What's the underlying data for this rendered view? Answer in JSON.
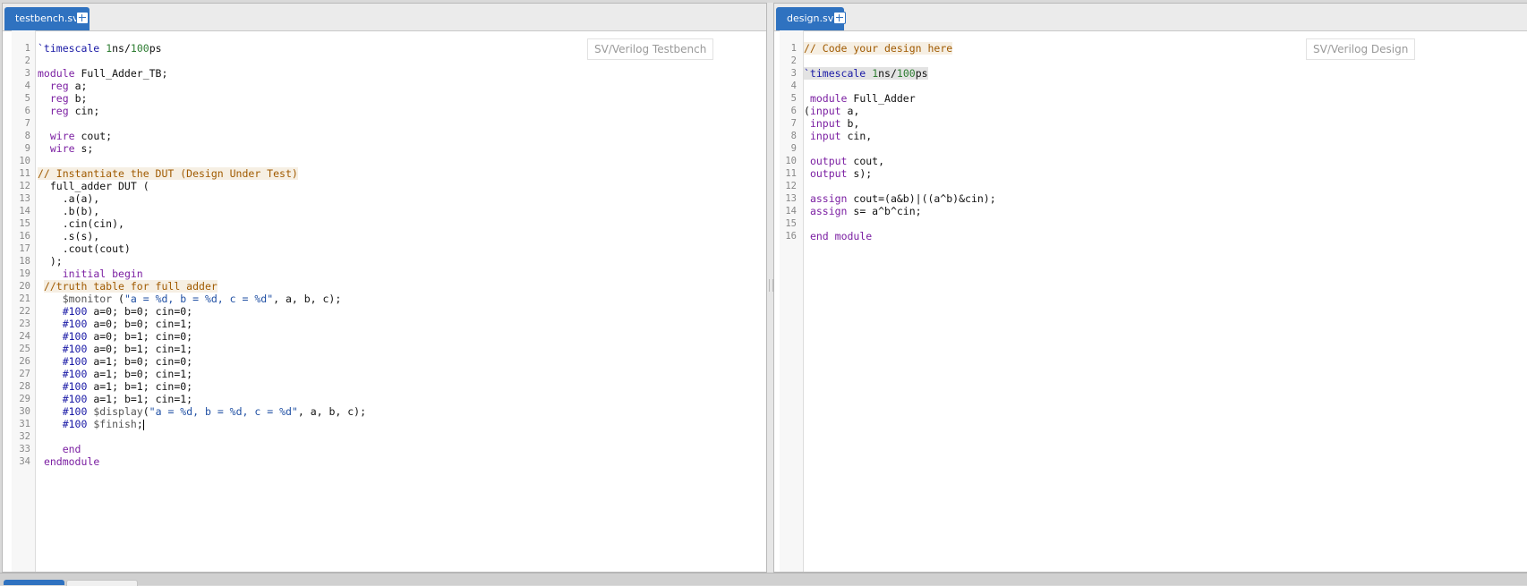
{
  "left": {
    "tab_label": "testbench.sv",
    "hint": "SV/Verilog Testbench",
    "lines": [
      {
        "n": "1",
        "t": "`timescale 1ns/100ps"
      },
      {
        "n": "2",
        "t": ""
      },
      {
        "n": "3",
        "t": "module Full_Adder_TB;"
      },
      {
        "n": "4",
        "t": "  reg a;"
      },
      {
        "n": "5",
        "t": "  reg b;"
      },
      {
        "n": "6",
        "t": "  reg cin;"
      },
      {
        "n": "7",
        "t": ""
      },
      {
        "n": "8",
        "t": "  wire cout;"
      },
      {
        "n": "9",
        "t": "  wire s;"
      },
      {
        "n": "10",
        "t": ""
      },
      {
        "n": "11",
        "t": "// Instantiate the DUT (Design Under Test)"
      },
      {
        "n": "12",
        "t": "  full_adder DUT ("
      },
      {
        "n": "13",
        "t": "    .a(a),"
      },
      {
        "n": "14",
        "t": "    .b(b),"
      },
      {
        "n": "15",
        "t": "    .cin(cin),"
      },
      {
        "n": "16",
        "t": "    .s(s),"
      },
      {
        "n": "17",
        "t": "    .cout(cout)"
      },
      {
        "n": "18",
        "t": "  );"
      },
      {
        "n": "19",
        "t": "    initial begin"
      },
      {
        "n": "20",
        "t": " //truth table for full adder"
      },
      {
        "n": "21",
        "t": "    $monitor (\"a = %d, b = %d, c = %d\", a, b, c);"
      },
      {
        "n": "22",
        "t": "    #100 a=0; b=0; cin=0;"
      },
      {
        "n": "23",
        "t": "    #100 a=0; b=0; cin=1;"
      },
      {
        "n": "24",
        "t": "    #100 a=0; b=1; cin=0;"
      },
      {
        "n": "25",
        "t": "    #100 a=0; b=1; cin=1;"
      },
      {
        "n": "26",
        "t": "    #100 a=1; b=0; cin=0;"
      },
      {
        "n": "27",
        "t": "    #100 a=1; b=0; cin=1;"
      },
      {
        "n": "28",
        "t": "    #100 a=1; b=1; cin=0;"
      },
      {
        "n": "29",
        "t": "    #100 a=1; b=1; cin=1;"
      },
      {
        "n": "30",
        "t": "    #100 $display(\"a = %d, b = %d, c = %d\", a, b, c);"
      },
      {
        "n": "31",
        "t": "    #100 $finish;"
      },
      {
        "n": "32",
        "t": ""
      },
      {
        "n": "33",
        "t": "    end"
      },
      {
        "n": "34",
        "t": " endmodule"
      }
    ]
  },
  "right": {
    "tab_label": "design.sv",
    "hint": "SV/Verilog Design",
    "lines": [
      {
        "n": "1",
        "t": "// Code your design here"
      },
      {
        "n": "2",
        "t": ""
      },
      {
        "n": "3",
        "t": "`timescale 1ns/100ps"
      },
      {
        "n": "4",
        "t": ""
      },
      {
        "n": "5",
        "t": " module Full_Adder"
      },
      {
        "n": "6",
        "t": "(input a,"
      },
      {
        "n": "7",
        "t": " input b,"
      },
      {
        "n": "8",
        "t": " input cin,"
      },
      {
        "n": "9",
        "t": ""
      },
      {
        "n": "10",
        "t": " output cout,"
      },
      {
        "n": "11",
        "t": " output s);"
      },
      {
        "n": "12",
        "t": ""
      },
      {
        "n": "13",
        "t": " assign cout=(a&b)|((a^b)&cin);"
      },
      {
        "n": "14",
        "t": " assign s= a^b^cin;"
      },
      {
        "n": "15",
        "t": ""
      },
      {
        "n": "16",
        "t": " end module"
      }
    ]
  }
}
